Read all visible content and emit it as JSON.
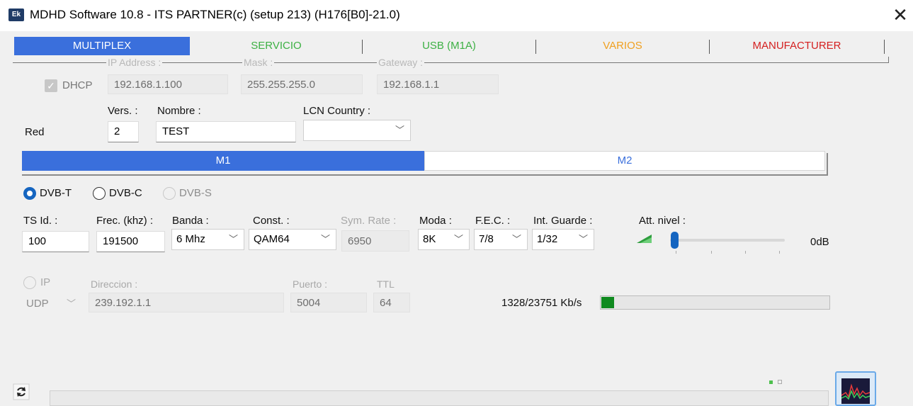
{
  "window": {
    "app_icon": "Ek",
    "title": "MDHD Software 10.8 - ITS PARTNER(c) (setup 213) (H176[B0]-21.0)",
    "close_glyph": "✕"
  },
  "main_tabs": [
    {
      "label": "MULTIPLEX",
      "color": "#ffffff",
      "active": true
    },
    {
      "label": "SERVICIO",
      "color": "#3cb043"
    },
    {
      "label": "USB (M1A)",
      "color": "#3cb043"
    },
    {
      "label": "VARIOS",
      "color": "#f0a020"
    },
    {
      "label": "MANUFACTURER",
      "color": "#d42020"
    }
  ],
  "network": {
    "dhcp_label": "DHCP",
    "dhcp_checked": true,
    "ip_caption": "IP Address :",
    "mask_caption": "Mask :",
    "gateway_caption": "Gateway :",
    "ip": "192.168.1.100",
    "mask": "255.255.255.0",
    "gateway": "192.168.1.1"
  },
  "red": {
    "red_label": "Red",
    "vers_label": "Vers. :",
    "vers_value": "2",
    "nombre_label": "Nombre :",
    "nombre_value": "TEST",
    "lcn_label": "LCN Country :",
    "lcn_value": ""
  },
  "sub_tabs": [
    {
      "label": "M1",
      "active": true
    },
    {
      "label": "M2"
    }
  ],
  "modulation": {
    "options": [
      "DVB-T",
      "DVB-C",
      "DVB-S"
    ],
    "selected": "DVB-T"
  },
  "params": {
    "tsid_label": "TS Id. :",
    "tsid_value": "100",
    "frec_label": "Frec. (khz) :",
    "frec_value": "191500",
    "banda_label": "Banda :",
    "banda_value": "6 Mhz",
    "const_label": "Const. :",
    "const_value": "QAM64",
    "symrate_label": "Sym. Rate :",
    "symrate_value": "6950",
    "moda_label": "Moda :",
    "moda_value": "8K",
    "fec_label": "F.E.C. :",
    "fec_value": "7/8",
    "guard_label": "Int. Guarde :",
    "guard_value": "1/32",
    "att_label": "Att. nivel :",
    "att_value": "0dB",
    "att_level": 0
  },
  "ip_output": {
    "ip_label": "IP",
    "protocol": "UDP",
    "direccion_label": "Direccion :",
    "direccion_value": "239.192.1.1",
    "puerto_label": "Puerto :",
    "puerto_value": "5004",
    "ttl_label": "TTL",
    "ttl_value": "64"
  },
  "bitrate": {
    "text": "1328/23751 Kb/s",
    "fraction": 0.0559
  },
  "icons": {
    "refresh": "refresh-icon",
    "spectrum": "spectrum-icon",
    "signal": "signal-icon"
  }
}
